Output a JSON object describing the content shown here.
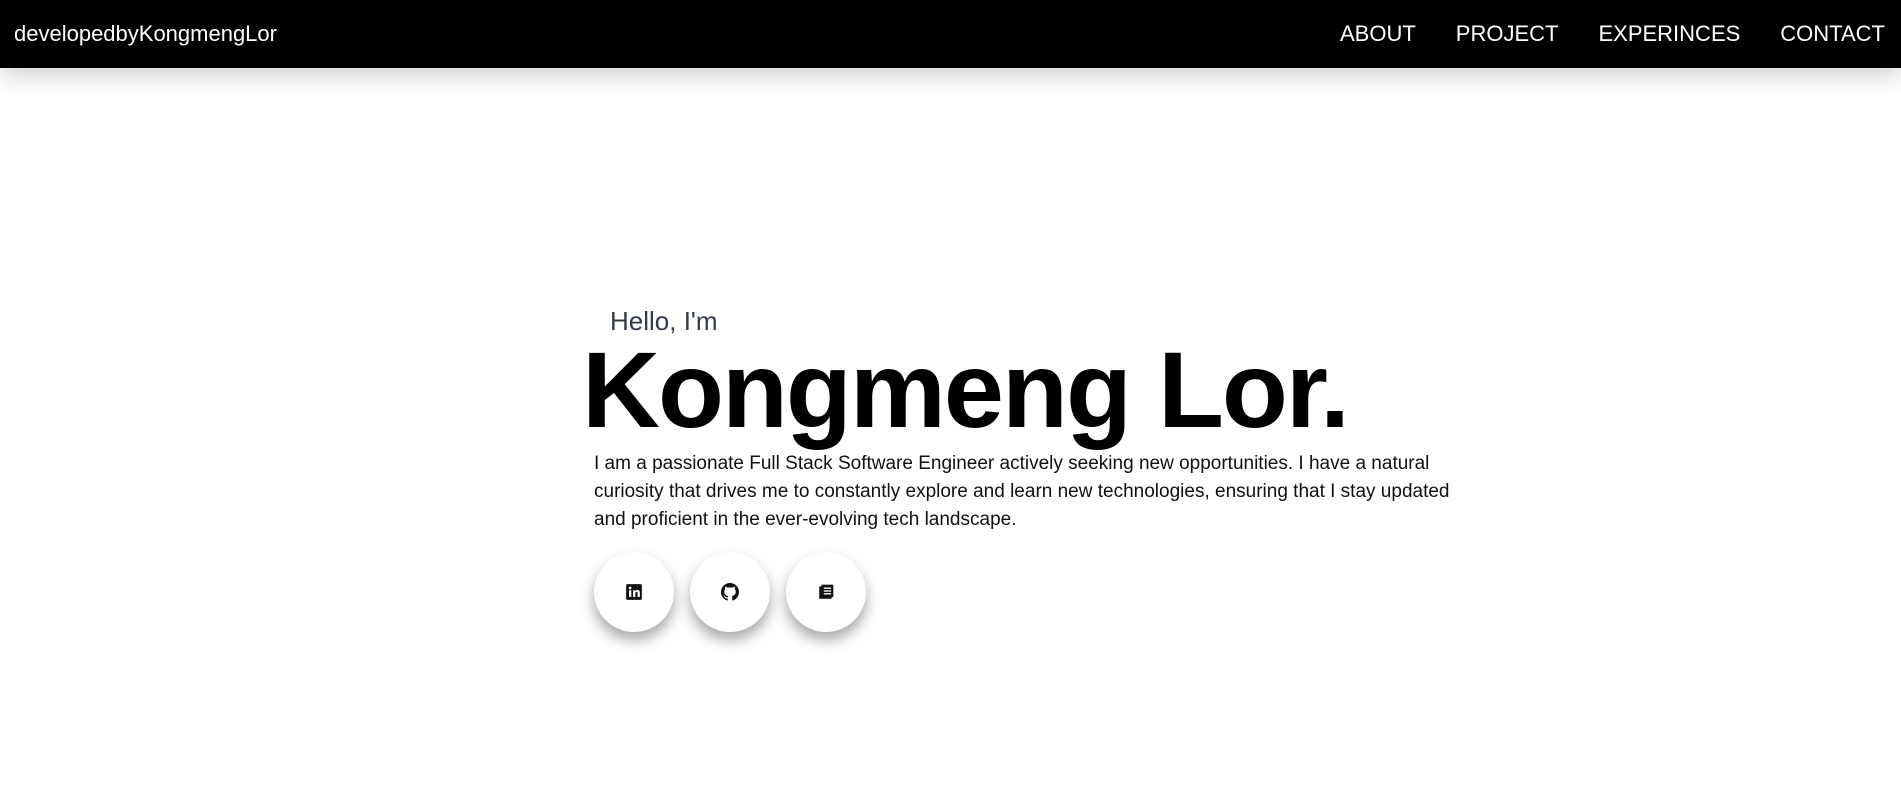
{
  "navbar": {
    "brand": "developedbyKongmengLor",
    "links": [
      {
        "label": "ABOUT"
      },
      {
        "label": "PROJECT"
      },
      {
        "label": "EXPERINCES"
      },
      {
        "label": "CONTACT"
      }
    ]
  },
  "hero": {
    "greeting": "Hello, I'm",
    "name": "Kongmeng Lor.",
    "bio": "I am a passionate Full Stack Software Engineer actively seeking new opportunities. I have a natural curiosity that drives me to constantly explore and learn new technologies, ensuring that I stay updated and proficient in the ever-evolving tech landscape."
  },
  "socials": [
    {
      "icon": "linkedin-icon"
    },
    {
      "icon": "github-icon"
    },
    {
      "icon": "resume-icon"
    }
  ],
  "colors": {
    "navbar_bg": "#000000",
    "nav_text": "#ffffff",
    "greeting_text": "#333b48",
    "name_text": "#000000"
  }
}
